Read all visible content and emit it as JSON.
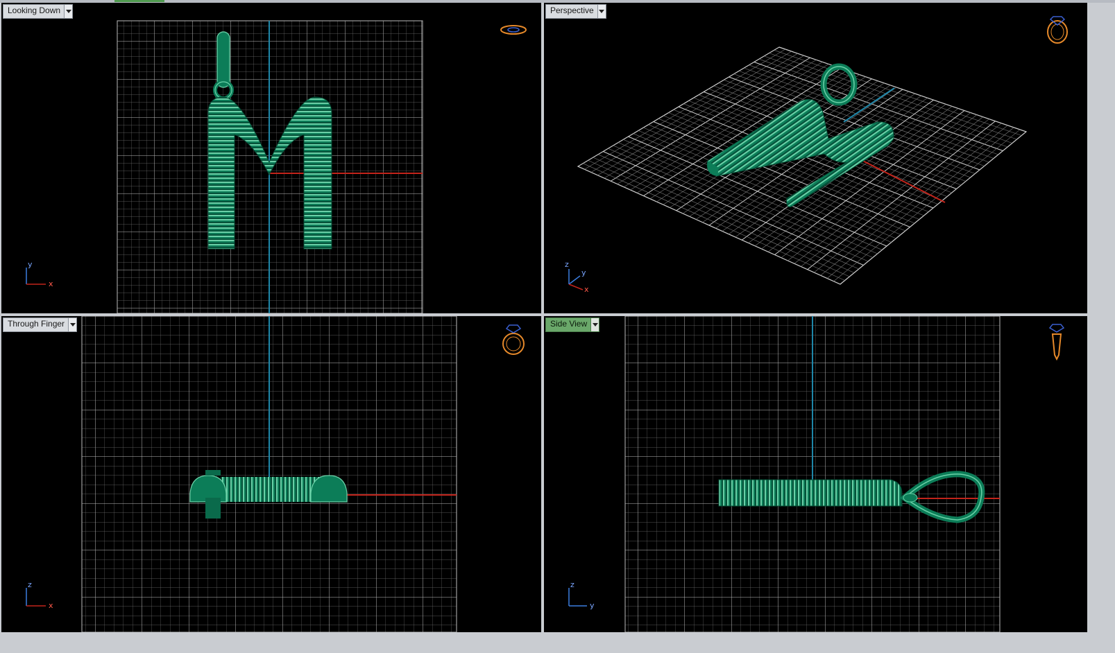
{
  "colors": {
    "background": "#000000",
    "grid": "#8a8a8a",
    "grid_major": "#c8c8c8",
    "axis_vertical": "#1e86a8",
    "axis_horizontal": "#c2241b",
    "model_green": "#0f8a62",
    "model_highlight": "#7ad8b2",
    "active_label": "#6aa86a",
    "nav_orange": "#e6892a",
    "nav_blue": "#3a5fd0"
  },
  "viewports": [
    {
      "label": "Looking Down",
      "axis_labels": [
        "y",
        "x"
      ],
      "nav_icon": "ring-top-icon"
    },
    {
      "label": "Perspective",
      "axis_labels": [
        "z",
        "y",
        "x"
      ],
      "nav_icon": "ring-perspective-icon"
    },
    {
      "label": "Through Finger",
      "axis_labels": [
        "z",
        "x"
      ],
      "nav_icon": "ring-front-icon"
    },
    {
      "label": "Side View",
      "axis_labels": [
        "z",
        "y"
      ],
      "nav_icon": "ring-side-icon",
      "active": true
    }
  ]
}
